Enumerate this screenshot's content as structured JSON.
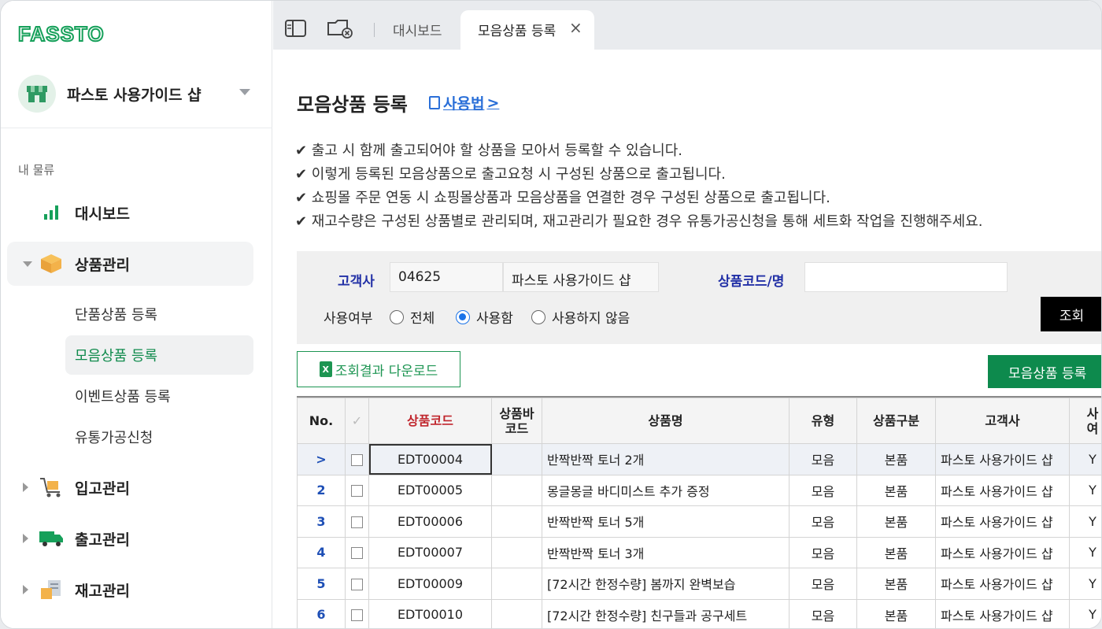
{
  "app": {
    "logo_text": "FASSTO"
  },
  "sidebar": {
    "store_name": "파스토 사용가이드 샵",
    "section_label": "내 물류",
    "items": [
      {
        "label": "대시보드",
        "icon": "bar-chart-icon"
      },
      {
        "label": "상품관리",
        "icon": "box-icon",
        "expanded": true
      },
      {
        "label": "입고관리",
        "icon": "cart-icon"
      },
      {
        "label": "출고관리",
        "icon": "truck-icon"
      },
      {
        "label": "재고관리",
        "icon": "inventory-icon"
      }
    ],
    "sub_items": [
      {
        "label": "단품상품 등록"
      },
      {
        "label": "모음상품 등록",
        "active": true
      },
      {
        "label": "이벤트상품 등록"
      },
      {
        "label": "유통가공신청"
      }
    ]
  },
  "tabs": {
    "dashboard_label": "대시보드",
    "active_label": "모음상품 등록",
    "close_glyph": "×"
  },
  "page": {
    "title": "모음상품 등록",
    "howto_label": "사용법",
    "howto_chevron": ">",
    "notes": [
      "✔ 출고 시 함께 출고되어야 할 상품을 모아서 등록할 수 있습니다.",
      "✔ 이렇게 등록된 모음상품으로 출고요청 시 구성된 상품으로 출고됩니다.",
      "✔ 쇼핑몰 주문 연동 시 쇼핑몰상품과 모음상품을 연결한 경우 구성된 상품으로 출고됩니다.",
      "✔ 재고수량은 구성된 상품별로 관리되며, 재고관리가 필요한 경우 유통가공신청을 통해 세트화 작업을 진행해주세요."
    ]
  },
  "filter": {
    "customer_label": "고객사",
    "customer_code": "04625",
    "customer_name": "파스토 사용가이드 샵",
    "product_label": "상품코드/명",
    "product_value": "",
    "use_label": "사용여부",
    "radio_all": "전체",
    "radio_used": "사용함",
    "radio_unused": "사용하지 않음",
    "selected": "사용함",
    "search_button": "조회"
  },
  "actions": {
    "download_label": "조회결과 다운로드",
    "excel_glyph": "X",
    "register_label": "모음상품 등록"
  },
  "table": {
    "headers": {
      "no": "No.",
      "check": "✓",
      "code": "상품코드",
      "barcode_1": "상품바",
      "barcode_2": "코드",
      "name": "상품명",
      "type": "유형",
      "category": "상품구분",
      "customer": "고객사",
      "use_1": "사",
      "use_2": "여"
    },
    "rows": [
      {
        "no": ">",
        "code": "EDT00004",
        "barcode": "",
        "name": "반짝반짝 토너 2개",
        "type": "모음",
        "category": "본품",
        "customer": "파스토 사용가이드 샵",
        "use": "Y"
      },
      {
        "no": "2",
        "code": "EDT00005",
        "barcode": "",
        "name": "몽글몽글 바디미스트 추가 증정",
        "type": "모음",
        "category": "본품",
        "customer": "파스토 사용가이드 샵",
        "use": "Y"
      },
      {
        "no": "3",
        "code": "EDT00006",
        "barcode": "",
        "name": "반짝반짝 토너 5개",
        "type": "모음",
        "category": "본품",
        "customer": "파스토 사용가이드 샵",
        "use": "Y"
      },
      {
        "no": "4",
        "code": "EDT00007",
        "barcode": "",
        "name": "반짝반짝 토너 3개",
        "type": "모음",
        "category": "본품",
        "customer": "파스토 사용가이드 샵",
        "use": "Y"
      },
      {
        "no": "5",
        "code": "EDT00009",
        "barcode": "",
        "name": "[72시간 한정수량] 봄까지 완벽보습",
        "type": "모음",
        "category": "본품",
        "customer": "파스토 사용가이드 샵",
        "use": "Y"
      },
      {
        "no": "6",
        "code": "EDT00010",
        "barcode": "",
        "name": "[72시간 한정수량] 친구들과 공구세트",
        "type": "모음",
        "category": "본품",
        "customer": "파스토 사용가이드 샵",
        "use": "Y"
      }
    ]
  },
  "colors": {
    "brand_green": "#0d8a4d",
    "link_blue": "#2a6fd8",
    "label_navy": "#2230a6",
    "code_header_red": "#c0262d"
  }
}
